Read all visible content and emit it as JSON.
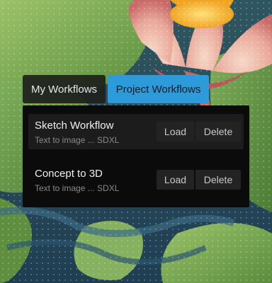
{
  "tabs": {
    "my_workflows": "My Workflows",
    "project_workflows": "Project Workflows",
    "active": "project_workflows"
  },
  "workflows": [
    {
      "title": "Sketch Workflow",
      "subtitle": "Text to image ... SDXL",
      "load": "Load",
      "delete": "Delete",
      "selected": true
    },
    {
      "title": "Concept to 3D",
      "subtitle": "Text to image ... SDXL",
      "load": "Load",
      "delete": "Delete",
      "selected": false
    }
  ],
  "colors": {
    "active_tab": "#2d9bd9",
    "panel_bg": "#0b0b0b"
  }
}
